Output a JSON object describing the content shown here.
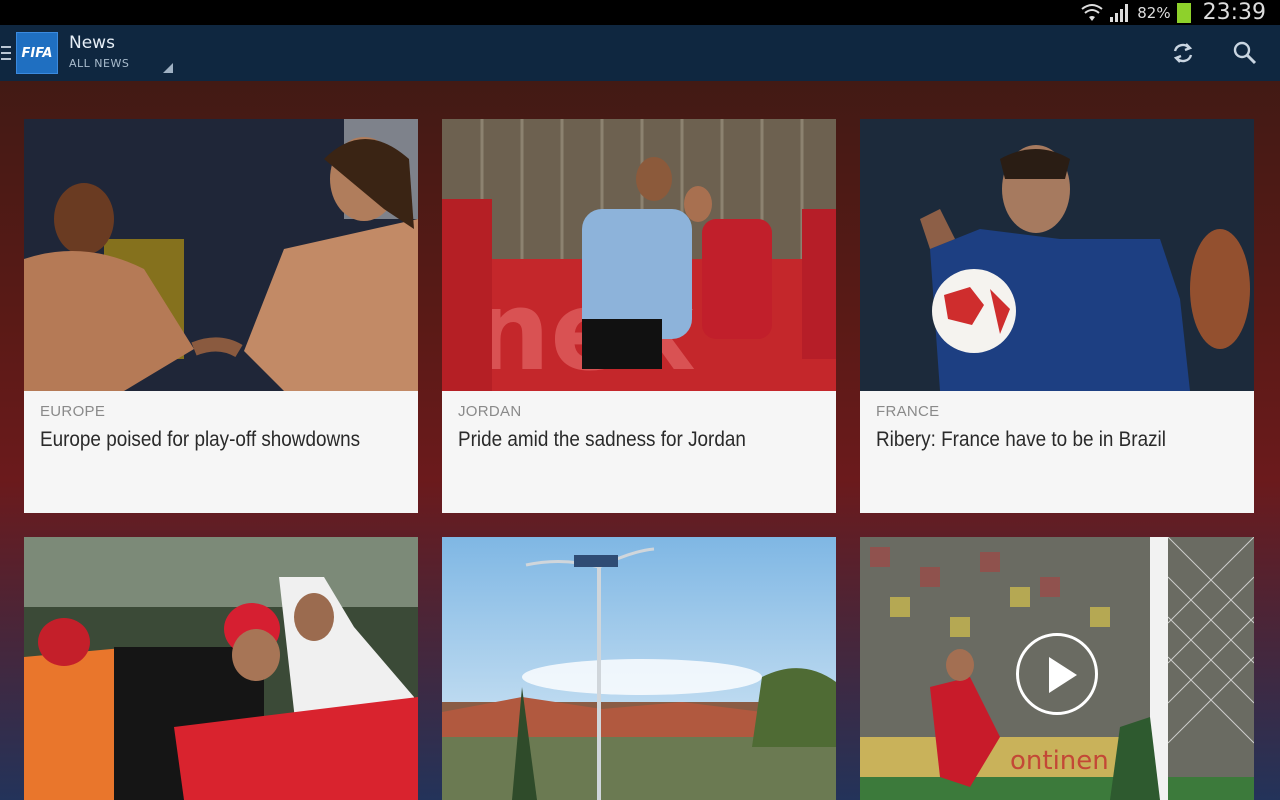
{
  "status_bar": {
    "battery_percent": "82%",
    "time": "23:39"
  },
  "action_bar": {
    "logo_text": "FIFA",
    "title": "News",
    "subtitle": "ALL NEWS",
    "refresh_icon": "refresh-icon",
    "search_icon": "search-icon"
  },
  "cards": [
    {
      "category": "EUROPE",
      "headline": "Europe poised for play-off showdowns",
      "image": "players-handshake-photo"
    },
    {
      "category": "JORDAN",
      "headline": "Pride amid the sadness for Jordan",
      "image": "uruguay-vs-jordan-photo"
    },
    {
      "category": "FRANCE",
      "headline": "Ribery: France have to be in Brazil",
      "image": "ribery-ball-photo"
    },
    {
      "category": "",
      "headline": "",
      "image": "celebrating-crowd-photo"
    },
    {
      "category": "",
      "headline": "",
      "image": "houses-streetlight-photo"
    },
    {
      "category": "",
      "headline": "",
      "image": "spain-goal-video-thumbnail",
      "video": true
    }
  ],
  "colors": {
    "action_bar": "#0f2740",
    "status_bar": "#000000",
    "battery": "#8ed12b",
    "logo": "#1f6fc1"
  }
}
